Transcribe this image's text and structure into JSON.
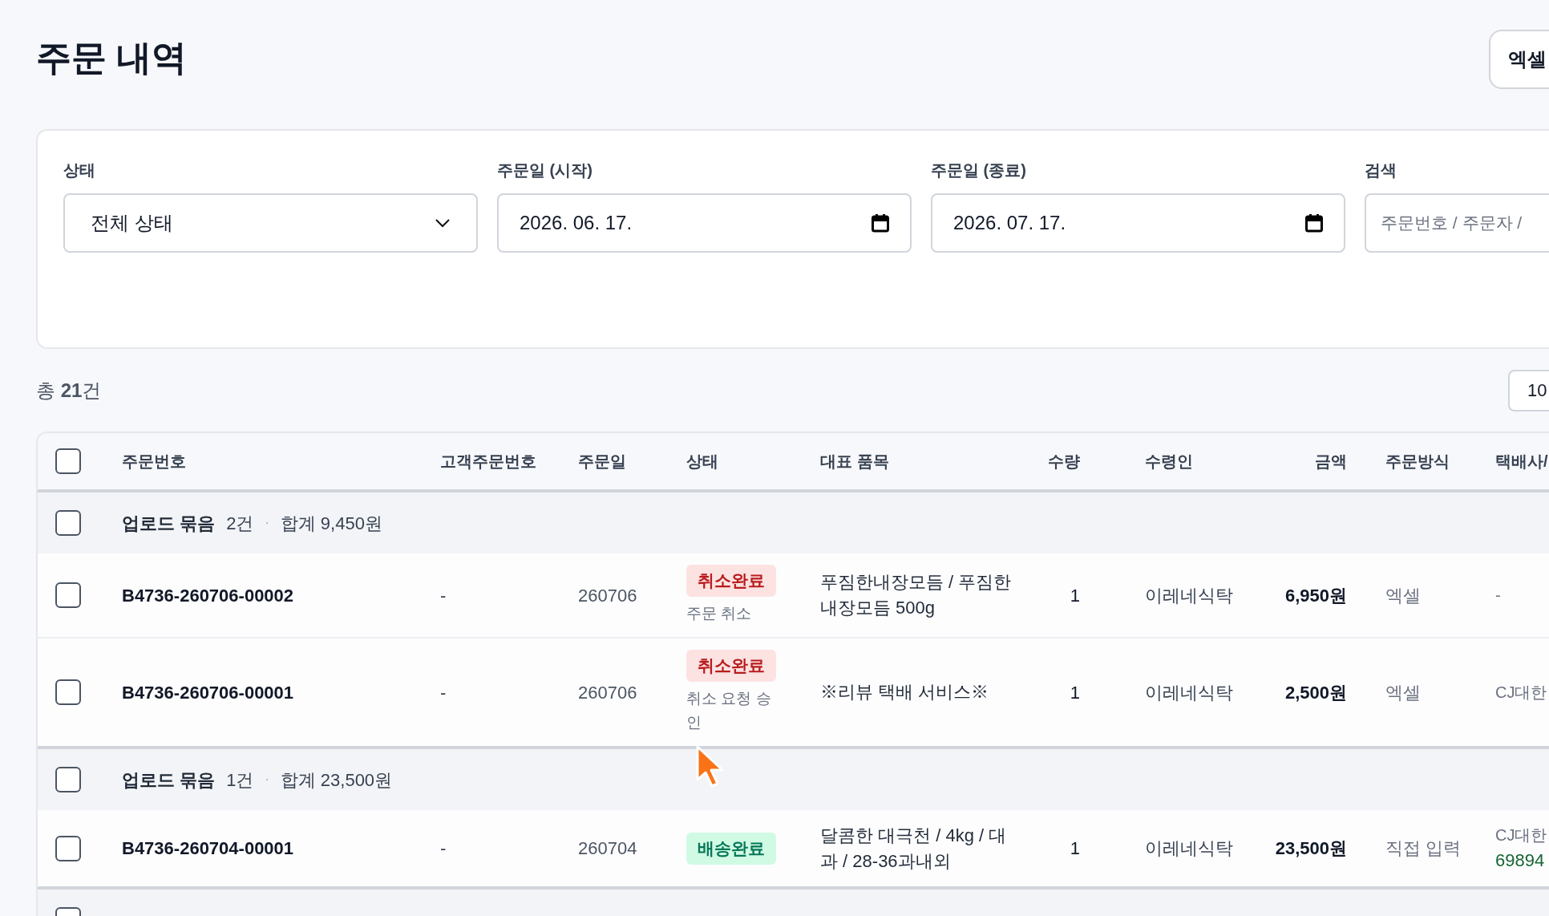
{
  "page": {
    "title": "주문 내역",
    "export_button": "엑셀"
  },
  "filters": {
    "status": {
      "label": "상태",
      "value": "전체 상태"
    },
    "date_from": {
      "label": "주문일 (시작)",
      "value": "2026. 06. 17."
    },
    "date_to": {
      "label": "주문일 (종료)",
      "value": "2026. 07. 17."
    },
    "search": {
      "label": "검색",
      "placeholder": "주문번호 / 주문자 /"
    }
  },
  "summary": "총 **21**건",
  "page_size": "10",
  "table": {
    "select_all_checked": false,
    "columns": [
      "주문번호",
      "고객주문번호",
      "주문일",
      "상태",
      "대표 품목",
      "수량",
      "수령인",
      "금액",
      "주문방식",
      "택배사/"
    ],
    "groups": [
      {
        "checked": false,
        "title": "업로드 묶음",
        "count": "2건",
        "separator": "·",
        "total": "합계 9,450원",
        "rows": [
          {
            "checked": false,
            "order_no": "B4736-260706-00002",
            "customer_order_no": "-",
            "date": "260706",
            "status": {
              "label": "취소완료",
              "kind": "cancelled"
            },
            "status_note": "주문 취소",
            "item": "푸짐한내장모듬 / 푸짐한내장모듬 500g",
            "qty": "1",
            "recipient": "이레네식탁",
            "amount": "6,950원",
            "method": "엑셀",
            "courier": {
              "name": "-"
            }
          },
          {
            "checked": false,
            "order_no": "B4736-260706-00001",
            "customer_order_no": "-",
            "date": "260706",
            "status": {
              "label": "취소완료",
              "kind": "cancelled"
            },
            "status_note": "취소 요청 승인",
            "item": "※리뷰 택배 서비스※",
            "qty": "1",
            "recipient": "이레네식탁",
            "amount": "2,500원",
            "method": "엑셀",
            "courier": {
              "name": "CJ대한"
            }
          }
        ]
      },
      {
        "checked": false,
        "title": "업로드 묶음",
        "count": "1건",
        "separator": "·",
        "total": "합계 23,500원",
        "rows": [
          {
            "checked": false,
            "order_no": "B4736-260704-00001",
            "customer_order_no": "-",
            "date": "260704",
            "status": {
              "label": "배송완료",
              "kind": "delivered"
            },
            "item": "달콤한 대극천 / 4kg / 대과 / 28-36과내외",
            "qty": "1",
            "recipient": "이레네식탁",
            "amount": "23,500원",
            "method": "직접 입력",
            "courier": {
              "name": "CJ대한",
              "tracking": "69894"
            }
          }
        ]
      },
      {
        "checked": false
      }
    ]
  }
}
